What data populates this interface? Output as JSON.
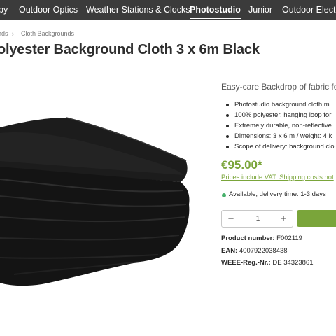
{
  "topnav": {
    "items": [
      "py",
      "Outdoor Optics",
      "Weather Stations & Clocks",
      "Photostudio",
      "Junior",
      "Outdoor Electro"
    ],
    "active_index": 3
  },
  "breadcrumb": {
    "items": [
      "nds",
      "Cloth Backgrounds"
    ],
    "separator": "›"
  },
  "product": {
    "title": "olyester Background Cloth 3 x 6m Black",
    "subtitle": "Easy-care Backdrop of fabric for",
    "features": [
      "Photostudio background cloth m",
      "100% polyester, hanging loop for",
      "Extremely durable, non-reflective",
      "Dimensions: 3 x 6 m / weight: 4 k",
      "Scope of delivery: background clo"
    ],
    "price": "€95.00*",
    "price_note": "Prices include VAT. Shipping costs not",
    "availability": "Available, delivery time: 1-3 days",
    "quantity": "1",
    "product_number_label": "Product number:",
    "product_number": "F002119",
    "ean_label": "EAN:",
    "ean": "4007922038438",
    "weee_label": "WEEE-Reg.-Nr.:",
    "weee": "DE 34323861"
  },
  "colors": {
    "nav_bg": "#3b3b3b",
    "accent_green": "#7aa53a",
    "availability_dot": "#47b06b"
  },
  "icons": {
    "breadcrumb_separator": "chevron-right-icon",
    "qty_minus": "minus-icon",
    "qty_plus": "plus-icon"
  }
}
